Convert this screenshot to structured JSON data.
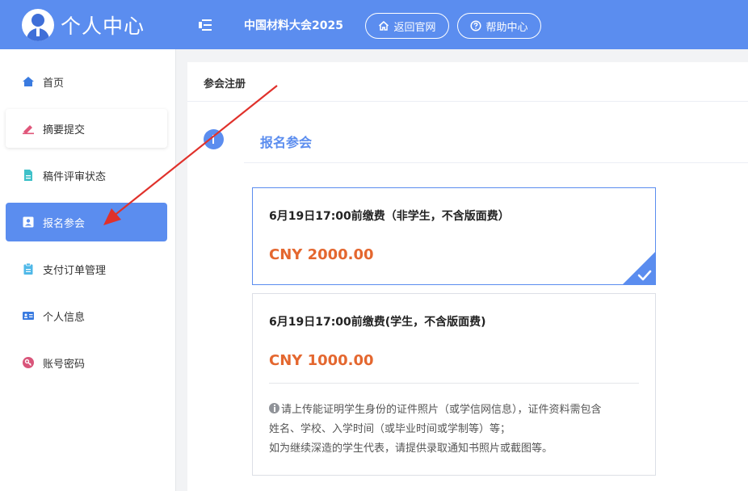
{
  "header": {
    "brand_title": "个人中心",
    "conference_title": "中国材料大会2025",
    "home_button": "返回官网",
    "help_button": "帮助中心"
  },
  "sidebar": {
    "items": [
      {
        "label": "首页",
        "icon": "home-icon",
        "color": "#3a7be0"
      },
      {
        "label": "摘要提交",
        "icon": "pen-icon",
        "color": "#e0567a"
      },
      {
        "label": "稿件评审状态",
        "icon": "document-icon",
        "color": "#3fc1c9"
      },
      {
        "label": "报名参会",
        "icon": "id-badge-icon",
        "color": "#ffffff"
      },
      {
        "label": "支付订单管理",
        "icon": "clipboard-icon",
        "color": "#4fb8e8"
      },
      {
        "label": "个人信息",
        "icon": "id-card-icon",
        "color": "#3a7be0"
      },
      {
        "label": "账号密码",
        "icon": "key-icon",
        "color": "#d9557a"
      }
    ],
    "active_index": 3
  },
  "main": {
    "tab_title": "参会注册",
    "step_title": "报名参会",
    "options": [
      {
        "name": "6月19日17:00前缴费（非学生，不含版面费）",
        "price": "CNY 2000.00",
        "selected": true
      },
      {
        "name": "6月19日17:00前缴费(学生，不含版面费)",
        "price": "CNY 1000.00",
        "selected": false,
        "note_lines": [
          "请上传能证明学生身份的证件照片（或学信网信息），证件资料需包含",
          "姓名、学校、入学时间（或毕业时间或学制等）等；",
          "如为继续深造的学生代表，请提供录取通知书照片或截图等。"
        ]
      }
    ]
  },
  "colors": {
    "primary": "#5b8def",
    "price": "#e4672f",
    "arrow": "#e0312b"
  }
}
